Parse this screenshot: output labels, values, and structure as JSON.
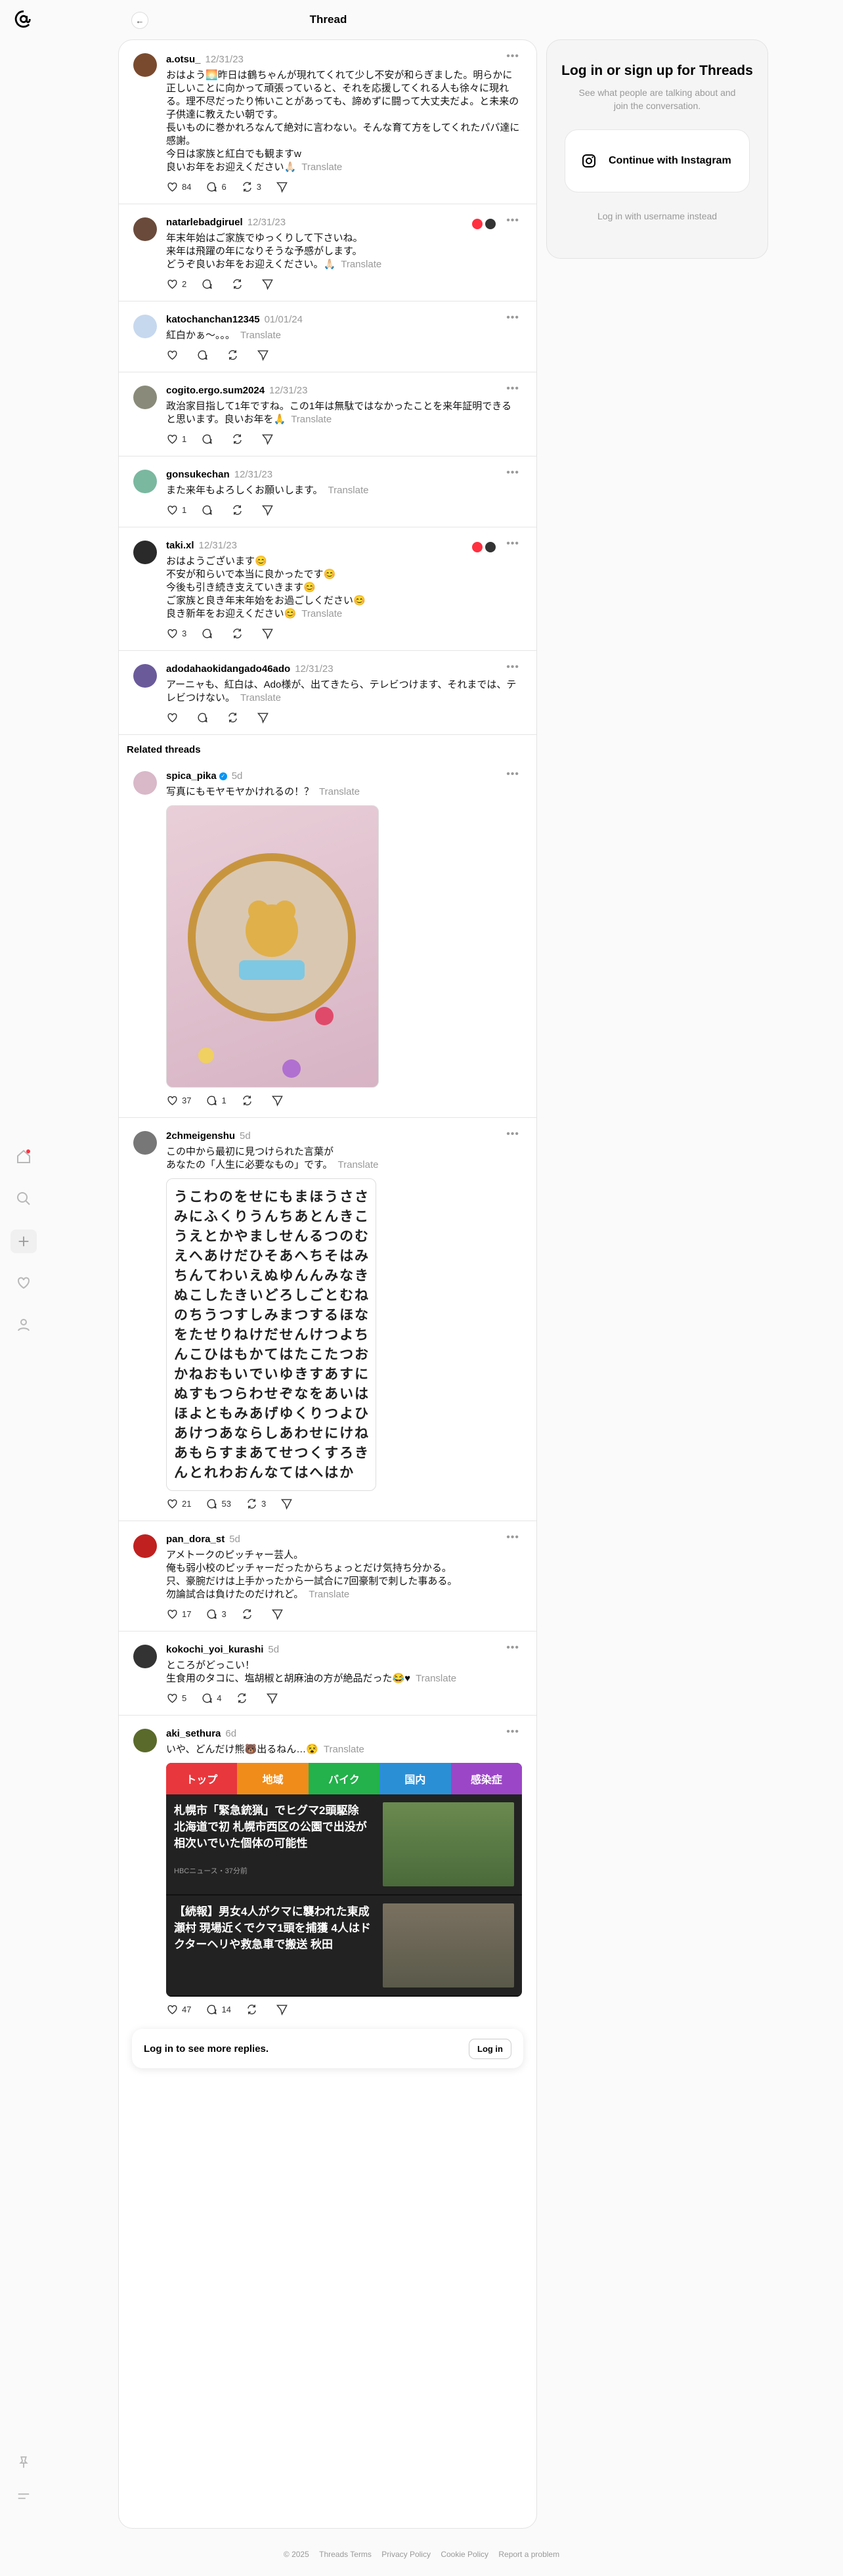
{
  "header": {
    "title": "Thread"
  },
  "main_post": {
    "user": "a.otsu_",
    "time": "12/31/23",
    "text": "おはよう🌅昨日は鶴ちゃんが現れてくれて少し不安が和らぎました。明らかに正しいことに向かって頑張っていると、それを応援してくれる人も徐々に現れる。理不尽だったり怖いことがあっても、諦めずに闘って大丈夫だよ。と未来の子供達に教えたい朝です。\n長いものに巻かれろなんて絶対に言わない。そんな育て方をしてくれたパパ達に感謝。\n今日は家族と紅白でも観ますw\n良いお年をお迎えください🙏🏻",
    "translate": "Translate",
    "likes": "84",
    "replies": "6",
    "reposts": "3"
  },
  "replies": [
    {
      "user": "natarlebadgiruel",
      "time": "12/31/23",
      "text": "年末年始はご家族でゆっくりして下さいね。\n来年は飛躍の年になりそうな予感がします。\nどうぞ良いお年をお迎えください。🙏🏻",
      "translate": "Translate",
      "likes": "2",
      "replies": "",
      "reposts": ""
    },
    {
      "user": "katochanchan12345",
      "time": "01/01/24",
      "text": "紅白かぁ〜。。。",
      "translate": "Translate",
      "likes": "",
      "replies": "",
      "reposts": ""
    },
    {
      "user": "cogito.ergo.sum2024",
      "time": "12/31/23",
      "text": "政治家目指して1年ですね。この1年は無駄ではなかったことを来年証明できると思います。良いお年を🙏",
      "translate": "Translate",
      "likes": "1",
      "replies": "",
      "reposts": ""
    },
    {
      "user": "gonsukechan",
      "time": "12/31/23",
      "text": "また来年もよろしくお願いします。",
      "translate": "Translate",
      "likes": "1",
      "replies": "",
      "reposts": ""
    },
    {
      "user": "taki.xl",
      "time": "12/31/23",
      "text": "おはようございます😊\n不安が和らいで本当に良かったです😊\n今後も引き続き支えていきます😊\nご家族と良き年末年始をお過ごしください😊\n良き新年をお迎えください😊",
      "translate": "Translate",
      "likes": "3",
      "replies": "",
      "reposts": ""
    },
    {
      "user": "adodahaokidangado46ado",
      "time": "12/31/23",
      "text": "アーニャも、紅白は、Ado様が、出てきたら、テレビつけます、それまでは、テレビつけない。",
      "translate": "Translate",
      "likes": "",
      "replies": "",
      "reposts": ""
    }
  ],
  "related_title": "Related threads",
  "related": [
    {
      "user": "spica_pika",
      "time": "5d",
      "text": "写真にもモヤモヤかけれるの！？",
      "translate": "Translate",
      "likes": "37",
      "replies": "1",
      "reposts": ""
    },
    {
      "user": "2chmeigenshu",
      "time": "5d",
      "text": "この中から最初に見つけられた言葉が\nあなたの「人生に必要なもの」です。",
      "translate": "Translate",
      "likes": "21",
      "replies": "53",
      "reposts": "3"
    },
    {
      "user": "pan_dora_st",
      "time": "5d",
      "text": "アメトークのピッチャー芸人。\n俺も弱小校のピッチャーだったからちょっとだけ気持ち分かる。\n只、豪腕だけは上手かったから一試合に7回豪制で刺した事ある。\n勿論試合は負けたのだけれど。",
      "translate": "Translate",
      "likes": "17",
      "replies": "3",
      "reposts": ""
    },
    {
      "user": "kokochi_yoi_kurashi",
      "time": "5d",
      "text": "ところがどっこい！\n生食用のタコに、塩胡椒と胡麻油の方が絶品だった😂♥",
      "translate": "Translate",
      "likes": "5",
      "replies": "4",
      "reposts": ""
    },
    {
      "user": "aki_sethura",
      "time": "6d",
      "text": "いや、どんだけ熊🐻出るねん…😵",
      "translate": "Translate",
      "likes": "47",
      "replies": "14",
      "reposts": ""
    }
  ],
  "grid_rows": [
    "うこわのをせにもまほうささみ",
    "にふくりうんちあとんきこうえ",
    "とかやましせんるつのむえへあ",
    "けだひそあへちそはみちんてわ",
    "いえぬゆんんみなきぬこした",
    "きいどろしごとむねのちうつす",
    "しみまつするほなをたせりねけ",
    "だせんけつよちんこひはもかて",
    "はたこたつおかねおもいでいゆ",
    "きすあすにぬすもつらわせぞな",
    "をあいはほよともみあげゆくり",
    "つよひあけつあならしあわせに",
    "けねあもらすまあてせつくす",
    "ろきんとれわおんなてはへはか"
  ],
  "news": {
    "tabs": [
      "トップ",
      "地域",
      "バイク",
      "国内",
      "感染症"
    ],
    "tab_colors": [
      "#e8373d",
      "#f08c1a",
      "#23b24b",
      "#2b8fd6",
      "#9b46c7"
    ],
    "items": [
      {
        "title": "札幌市「緊急銃猟」でヒグマ2頭駆除　北海道で初 札幌市西区の公園で出没が相次いでいた個体の可能性",
        "source": "HBCニュース・37分前"
      },
      {
        "title": "【続報】男女4人がクマに襲われた東成瀬村 現場近くでクマ1頭を捕獲 4人はドクターヘリや救急車で搬送 秋田",
        "source": ""
      }
    ]
  },
  "login_bar": {
    "text": "Log in to see more replies.",
    "button": "Log in"
  },
  "sidebar": {
    "title": "Log in or sign up for Threads",
    "subtitle": "See what people are talking about and join the conversation.",
    "button": "Continue with Instagram",
    "username_link": "Log in with username instead"
  },
  "footer": [
    "© 2025",
    "Threads Terms",
    "Privacy Policy",
    "Cookie Policy",
    "Report a problem"
  ]
}
